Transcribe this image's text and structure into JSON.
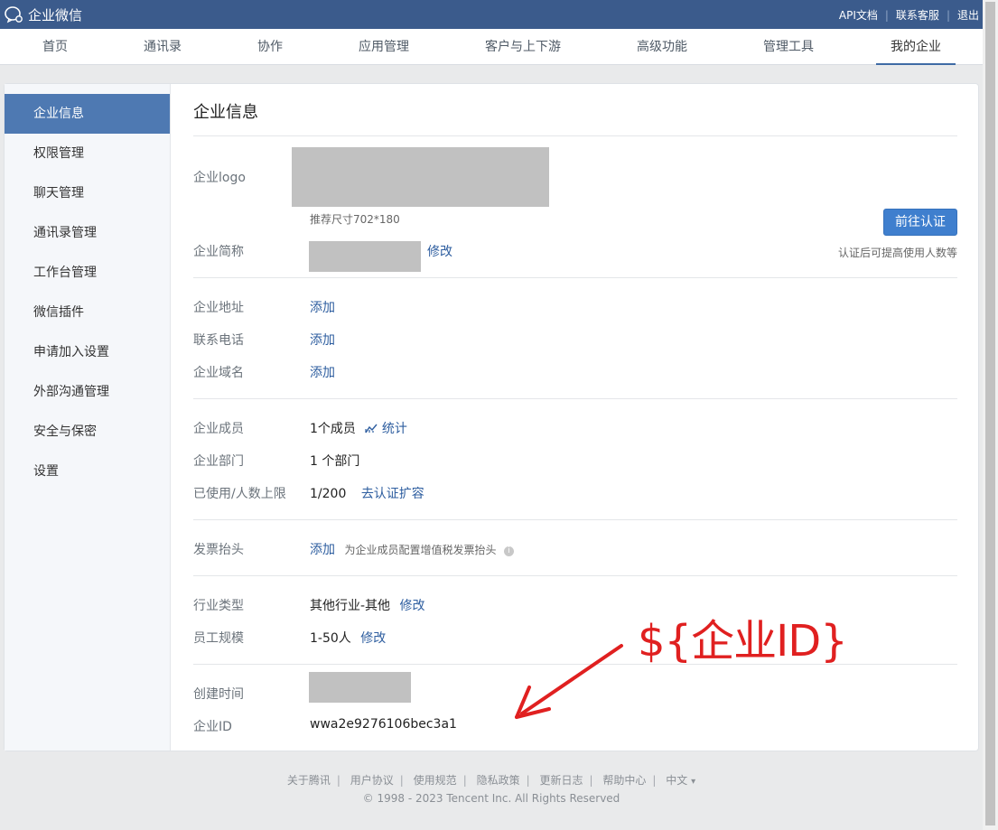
{
  "app": {
    "brand": "企业微信",
    "top_links": [
      "API文档",
      "联系客服",
      "退出"
    ]
  },
  "nav": {
    "items": [
      "首页",
      "通讯录",
      "协作",
      "应用管理",
      "客户与上下游",
      "高级功能",
      "管理工具",
      "我的企业"
    ],
    "active": "我的企业"
  },
  "sidebar": {
    "items": [
      "企业信息",
      "权限管理",
      "聊天管理",
      "通讯录管理",
      "工作台管理",
      "微信插件",
      "申请加入设置",
      "外部沟通管理",
      "安全与保密",
      "设置"
    ],
    "active": "企业信息"
  },
  "main": {
    "title": "企业信息",
    "logo": {
      "label": "企业logo",
      "hint": "推荐尺寸702*180"
    },
    "certify": {
      "button": "前往认证",
      "tip": "认证后可提高使用人数等"
    },
    "short_name": {
      "label": "企业简称",
      "action": "修改"
    },
    "address": {
      "label": "企业地址",
      "action": "添加"
    },
    "phone": {
      "label": "联系电话",
      "action": "添加"
    },
    "domain": {
      "label": "企业域名",
      "action": "添加"
    },
    "members": {
      "label": "企业成员",
      "value": "1个成员",
      "action": "统计"
    },
    "departments": {
      "label": "企业部门",
      "value": "1 个部门"
    },
    "usage": {
      "label": "已使用/人数上限",
      "value": "1/200",
      "action": "去认证扩容"
    },
    "invoice": {
      "label": "发票抬头",
      "action": "添加",
      "hint": "为企业成员配置增值税发票抬头",
      "info_icon": "i"
    },
    "industry": {
      "label": "行业类型",
      "value": "其他行业-其他",
      "action": "修改"
    },
    "scale": {
      "label": "员工规模",
      "value": "1-50人",
      "action": "修改"
    },
    "created": {
      "label": "创建时间"
    },
    "corp_id": {
      "label": "企业ID",
      "value": "wwa2e9276106bec3a1"
    }
  },
  "annotation": {
    "text": "${企业ID}",
    "color": "#e02020"
  },
  "footer": {
    "links": [
      "关于腾讯",
      "用户协议",
      "使用规范",
      "隐私政策",
      "更新日志",
      "帮助中心",
      "中文"
    ],
    "language_caret": "▾",
    "copyright": "© 1998 - 2023 Tencent Inc. All Rights Reserved"
  },
  "colors": {
    "header": "#3b5b8c",
    "accent": "#4e79b2",
    "link": "#2d5d9f",
    "button": "#3f7fce"
  },
  "icons": [
    "chat-bubbles-icon",
    "stats-chart-icon",
    "info-icon",
    "caret-down-icon"
  ]
}
